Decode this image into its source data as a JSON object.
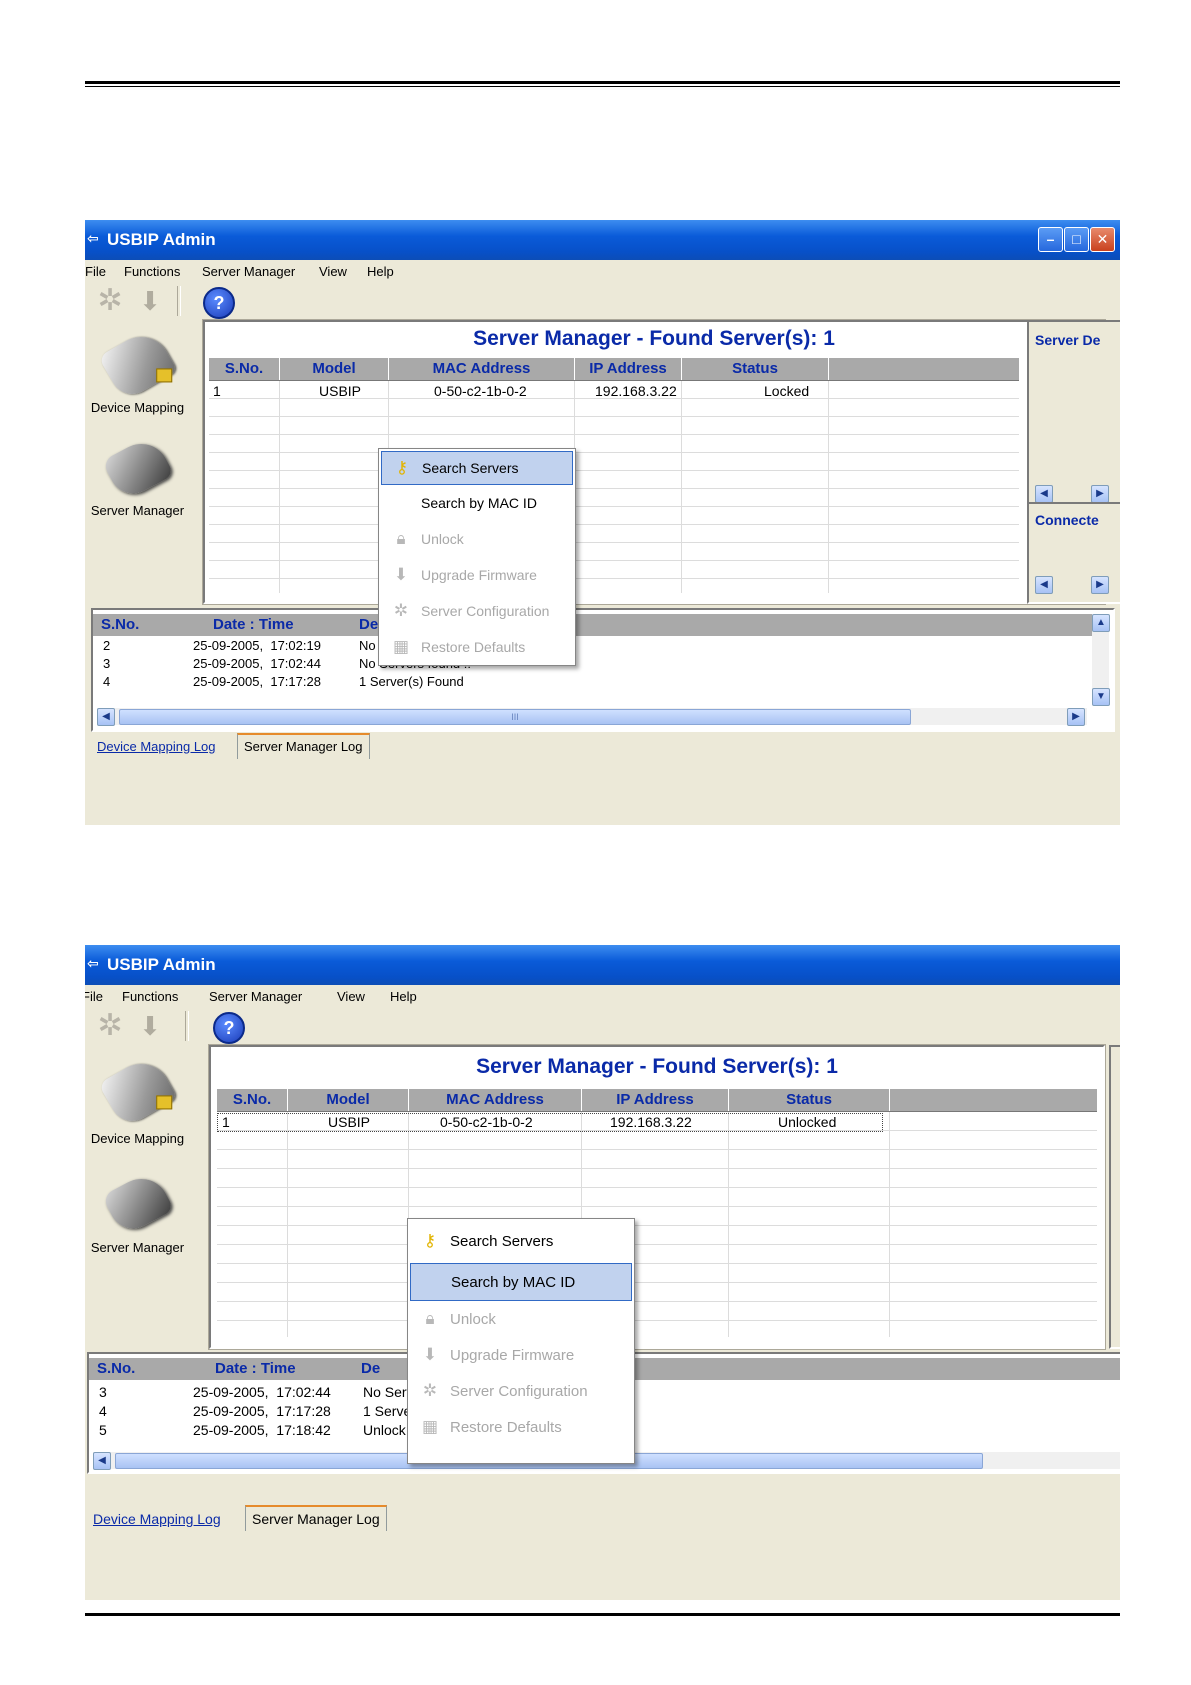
{
  "window": {
    "title": "USBIP Admin"
  },
  "menu": [
    "File",
    "Functions",
    "Server Manager",
    "View",
    "Help"
  ],
  "toolbar": {
    "help_glyph": "?"
  },
  "sidebar": {
    "device_mapping": "Device Mapping",
    "server_manager": "Server Manager"
  },
  "server_table": {
    "title": "Server Manager - Found Server(s): 1",
    "columns": [
      "S.No.",
      "Model",
      "MAC Address",
      "IP Address",
      "Status"
    ]
  },
  "right_panels": {
    "server_details": "Server De",
    "connected": "Connecte"
  },
  "context_menu": [
    "Search Servers",
    "Search by MAC ID",
    "Unlock",
    "Upgrade Firmware",
    "Server Configuration",
    "Restore Defaults"
  ],
  "log": {
    "columns": [
      "S.No.",
      "Date : Time",
      "Description"
    ],
    "scroll_marker": "III"
  },
  "tabs": {
    "device_mapping_log": "Device Mapping Log",
    "server_manager_log": "Server Manager Log"
  },
  "screenshot1": {
    "row": {
      "sno": "1",
      "model": "USBIP",
      "mac": "0-50-c2-1b-0-2",
      "ip": "192.168.3.22",
      "status": "Locked"
    },
    "highlighted_item": "Search Servers",
    "log_rows": [
      {
        "sno": "2",
        "datetime": "25-09-2005,  17:02:19",
        "desc": "No Servers found !!"
      },
      {
        "sno": "3",
        "datetime": "25-09-2005,  17:02:44",
        "desc": "No Servers found !!"
      },
      {
        "sno": "4",
        "datetime": "25-09-2005,  17:17:28",
        "desc": "1 Server(s) Found"
      }
    ]
  },
  "screenshot2": {
    "row": {
      "sno": "1",
      "model": "USBIP",
      "mac": "0-50-c2-1b-0-2",
      "ip": "192.168.3.22",
      "status": "Unlocked"
    },
    "highlighted_item": "Search by MAC ID",
    "log_header_desc": "De",
    "log_rows": [
      {
        "sno": "3",
        "datetime": "25-09-2005,  17:02:44",
        "desc": "No Servers found !!"
      },
      {
        "sno": "4",
        "datetime": "25-09-2005,  17:17:28",
        "desc": "1 Server(s) Found"
      },
      {
        "sno": "5",
        "datetime": "25-09-2005,  17:18:42",
        "desc": "Unlock successful !!"
      }
    ]
  },
  "colors": {
    "title_bar": "#0a5bd9",
    "header_text": "#0a2aa8",
    "menu_highlight": "#c1d2ee"
  },
  "icons": [
    "usb-app-icon",
    "gear-icon",
    "download-icon",
    "help-icon",
    "usb-device-icon",
    "server-device-icon",
    "key-icon",
    "lock-icon",
    "firmware-icon",
    "config-gear-icon",
    "restore-icon",
    "minimize-icon",
    "maximize-icon",
    "close-icon"
  ]
}
